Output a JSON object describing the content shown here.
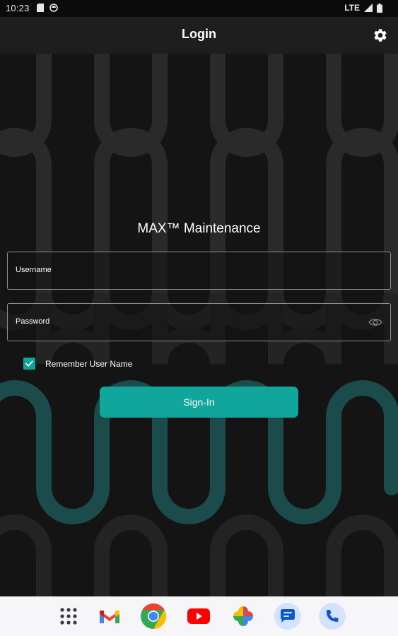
{
  "status_bar": {
    "time": "10:23",
    "network": "LTE",
    "icons": [
      "sd-card-icon",
      "sync-icon",
      "signal-icon",
      "battery-icon"
    ]
  },
  "app_bar": {
    "title": "Login",
    "settings_icon": "gear-icon"
  },
  "login": {
    "brand_title": "MAX™ Maintenance",
    "username_label": "Username",
    "username_value": "",
    "password_label": "Password",
    "password_value": "",
    "remember_label": "Remember User Name",
    "remember_checked": true,
    "signin_label": "Sign-In"
  },
  "dock": {
    "apps": [
      "app-drawer-icon",
      "gmail-icon",
      "chrome-icon",
      "youtube-icon",
      "photos-icon",
      "messages-icon",
      "phone-icon"
    ]
  },
  "colors": {
    "accent": "#10a69b",
    "background": "#141414",
    "app_bar": "#1e1e1e",
    "pattern_gray": "#2b2b2b",
    "pattern_teal": "#1b4c4c"
  }
}
